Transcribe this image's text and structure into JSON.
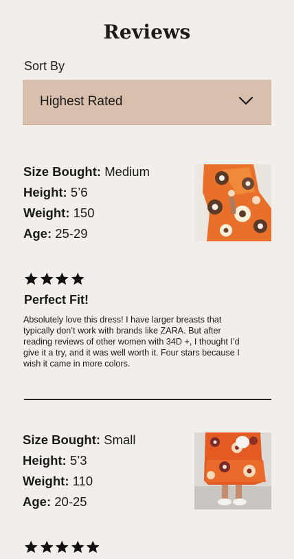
{
  "page": {
    "title": "Reviews"
  },
  "sort": {
    "label": "Sort By",
    "selected": "Highest Rated",
    "icon": "chevron-down-icon"
  },
  "reviews": [
    {
      "size_label": "Size Bought:",
      "size_value": "Medium",
      "height_label": "Height:",
      "height_value": "5’6",
      "weight_label": "Weight:",
      "weight_value": "150",
      "age_label": "Age:",
      "age_value": "25-29",
      "rating": 4,
      "title": "Perfect Fit!",
      "body": "Absolutely love this dress! I have larger breasts that typically don’t work with brands like ZARA. But after reading reviews of other women with 34D +, I thought I’d give it a try, and it was well worth it. Four stars because I wish it came in more colors."
    },
    {
      "size_label": "Size Bought:",
      "size_value": "Small",
      "height_label": "Height:",
      "height_value": "5’3",
      "weight_label": "Weight:",
      "weight_value": "110",
      "age_label": "Age:",
      "age_value": "20-25",
      "rating": 5
    }
  ],
  "colors": {
    "background": "#f2efea",
    "select_bg": "#d8bfae",
    "text": "#1a1a1a",
    "dress_orange": "#e8702a"
  }
}
